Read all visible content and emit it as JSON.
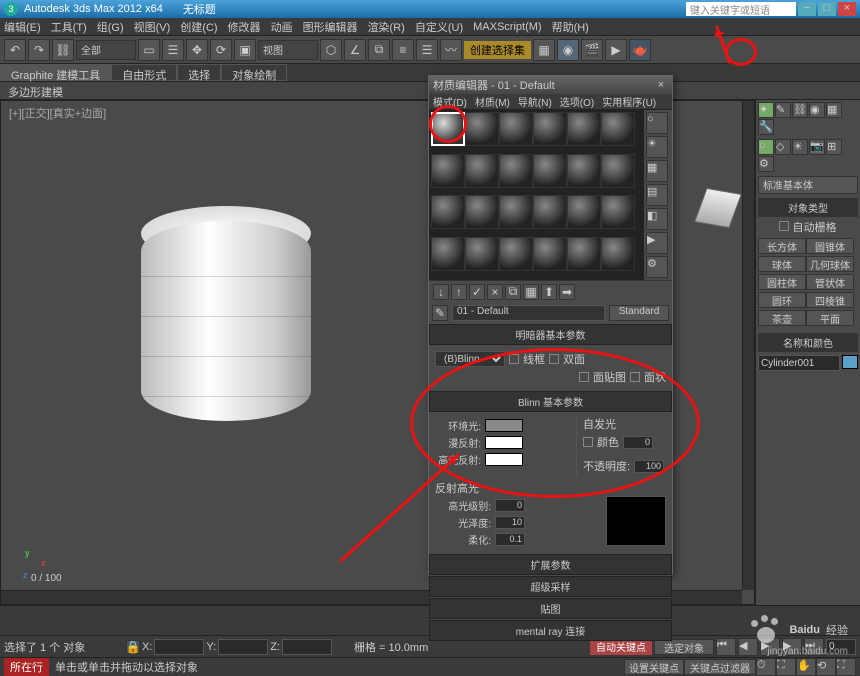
{
  "title_bar": {
    "app": "Autodesk 3ds Max 2012 x64",
    "doc": "无标题",
    "search_placeholder": "键入关键字或短语"
  },
  "menu": {
    "edit": "编辑(E)",
    "tools": "工具(T)",
    "group": "组(G)",
    "views": "视图(V)",
    "create": "创建(C)",
    "modifiers": "修改器",
    "animation": "动画",
    "graph": "图形编辑器",
    "rendering": "渲染(R)",
    "customize": "自定义(U)",
    "maxscript": "MAXScript(M)",
    "help": "帮助(H)"
  },
  "toolbar": {
    "dropdown_all": "全部",
    "dropdown_view": "视图",
    "snap_mode": "创建选择集"
  },
  "ribbon": {
    "tab1": "Graphite 建模工具",
    "tab2": "自由形式",
    "tab3": "选择",
    "tab4": "对象绘制",
    "sub": "多边形建模"
  },
  "viewport": {
    "label": "[+][正交][真实+边面]"
  },
  "frame_counter": "0 / 100",
  "mat_editor": {
    "title": "材质编辑器 - 01 - Default",
    "menu": {
      "modes": "模式(D)",
      "material": "材质(M)",
      "navigation": "导航(N)",
      "options": "选项(O)",
      "utilities": "实用程序(U)"
    },
    "name": "01 - Default",
    "type_btn": "Standard",
    "rollout_shader": "明暗器基本参数",
    "shader_dd": "(B)Blinn",
    "chk_wire": "线框",
    "chk_2sided": "双面",
    "chk_facemap": "面贴图",
    "chk_faceted": "面状",
    "rollout_basic": "Blinn 基本参数",
    "lbl_ambient": "环境光:",
    "lbl_diffuse": "漫反射:",
    "lbl_specular": "高光反射:",
    "lbl_selfillum": "自发光",
    "lbl_color": "颜色",
    "val_selfillum": "0",
    "lbl_opacity": "不透明度:",
    "val_opacity": "100",
    "section_spec": "反射高光",
    "lbl_spec_level": "高光级别:",
    "val_spec_level": "0",
    "lbl_gloss": "光泽度:",
    "val_gloss": "10",
    "lbl_soften": "柔化:",
    "val_soften": "0.1",
    "rollout_ext": "扩展参数",
    "rollout_ss": "超级采样",
    "rollout_maps": "贴图",
    "rollout_mr": "mental ray 连接"
  },
  "cmd_panel": {
    "dd": "标准基本体",
    "section_obj": "对象类型",
    "autogrid": "自动栅格",
    "btns": [
      "长方体",
      "圆锥体",
      "球体",
      "几何球体",
      "圆柱体",
      "管状体",
      "圆环",
      "四棱锥",
      "茶壶",
      "平面"
    ],
    "section_name": "名称和颜色",
    "obj_name": "Cylinder001"
  },
  "status": {
    "selected": "选择了 1 个 对象",
    "hint": "单击或单击并拖动以选择对象",
    "grid": "栅格 = 10.0mm",
    "autokey": "自动关键点",
    "selsetlock": "选定对象",
    "setkey": "设置关键点",
    "keyfilter": "关键点过滤器",
    "tag": "所在行",
    "frame_val": "0",
    "x": "X:",
    "y": "Y:",
    "z": "Z:"
  },
  "watermark": {
    "brand": "Baidu",
    "sub": "经验",
    "url": "jingyan.baidu.com"
  }
}
